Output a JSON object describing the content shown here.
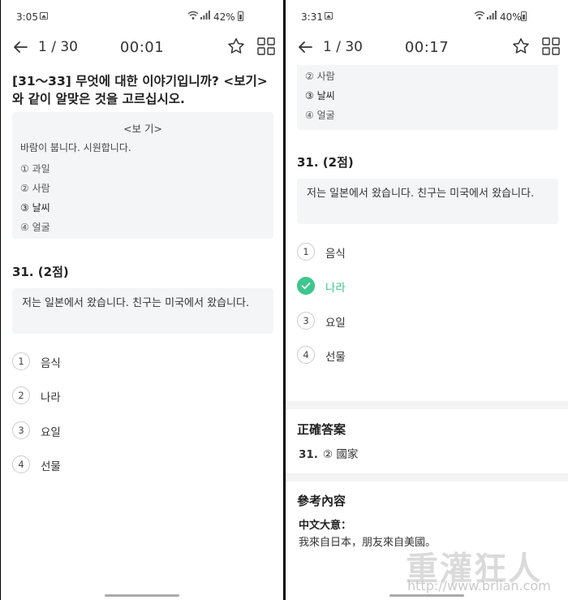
{
  "left": {
    "status": {
      "time": "3:05",
      "battery": "42%"
    },
    "header": {
      "progress": "1 / 30",
      "timer": "00:01"
    },
    "question_title": "[31～33] 무엇에 대한 이야기입니까? <보기>와 같이 알맞은 것을 고르십시오.",
    "example": {
      "title": "<보 기>",
      "sentence": "바람이 붑니다. 시원합니다.",
      "options": [
        {
          "num": "①",
          "text": "과일"
        },
        {
          "num": "②",
          "text": "사람"
        },
        {
          "num": "③",
          "text": "날씨"
        },
        {
          "num": "④",
          "text": "얼굴"
        }
      ]
    },
    "question_number": "31. (2점)",
    "passage": "저는 일본에서 왔습니다. 친구는 미국에서 왔습니다.",
    "choices": [
      {
        "num": "1",
        "text": "음식"
      },
      {
        "num": "2",
        "text": "나라"
      },
      {
        "num": "3",
        "text": "요일"
      },
      {
        "num": "4",
        "text": "선물"
      }
    ]
  },
  "right": {
    "status": {
      "time": "3:31",
      "battery": "40%"
    },
    "header": {
      "progress": "1 / 30",
      "timer": "00:17"
    },
    "example_options": [
      {
        "num": "②",
        "text": "사람"
      },
      {
        "num": "③",
        "text": "날씨"
      },
      {
        "num": "④",
        "text": "얼굴"
      }
    ],
    "question_number": "31. (2점)",
    "passage": "저는 일본에서 왔습니다. 친구는 미국에서 왔습니다.",
    "choices": [
      {
        "num": "1",
        "text": "음식"
      },
      {
        "num": "2",
        "text": "나라",
        "correct": true
      },
      {
        "num": "3",
        "text": "요일"
      },
      {
        "num": "4",
        "text": "선물"
      }
    ],
    "answer_section": {
      "title": "正確答案",
      "qnum": "31.",
      "answer": "② 國家"
    },
    "reference_section": {
      "title": "參考內容",
      "subtitle": "中文大意：",
      "text": "我來自日本，朋友來自美國。"
    }
  },
  "watermark": {
    "brand": "重灌狂人",
    "url": "http://www.brlian.com"
  },
  "colors": {
    "correct": "#3fc68c",
    "highlight": "#f7e15b",
    "box_bg": "#f4f5f7"
  }
}
